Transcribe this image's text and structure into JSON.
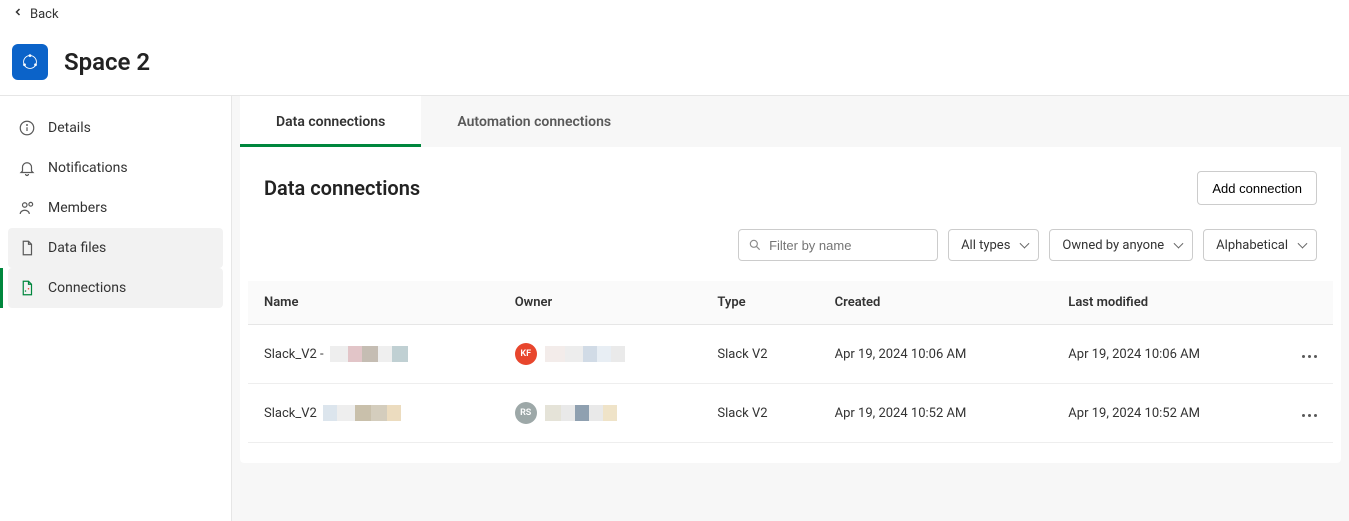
{
  "back_label": "Back",
  "space_title": "Space 2",
  "sidebar": {
    "items": [
      {
        "label": "Details"
      },
      {
        "label": "Notifications"
      },
      {
        "label": "Members"
      },
      {
        "label": "Data files"
      },
      {
        "label": "Connections"
      }
    ]
  },
  "tabs": [
    {
      "label": "Data connections"
    },
    {
      "label": "Automation connections"
    }
  ],
  "panel": {
    "title": "Data connections",
    "add_button": "Add connection"
  },
  "filters": {
    "search_placeholder": "Filter by name",
    "types": "All types",
    "owner": "Owned by anyone",
    "sort": "Alphabetical"
  },
  "table": {
    "columns": [
      "Name",
      "Owner",
      "Type",
      "Created",
      "Last modified"
    ],
    "rows": [
      {
        "name": "Slack_V2 -",
        "owner_initials": "KF",
        "owner_color": "#e8462d",
        "type": "Slack V2",
        "created": "Apr 19, 2024 10:06 AM",
        "modified": "Apr 19, 2024 10:06 AM"
      },
      {
        "name": "Slack_V2",
        "owner_initials": "RS",
        "owner_color": "#9da8a8",
        "type": "Slack V2",
        "created": "Apr 19, 2024 10:52 AM",
        "modified": "Apr 19, 2024 10:52 AM"
      }
    ]
  }
}
